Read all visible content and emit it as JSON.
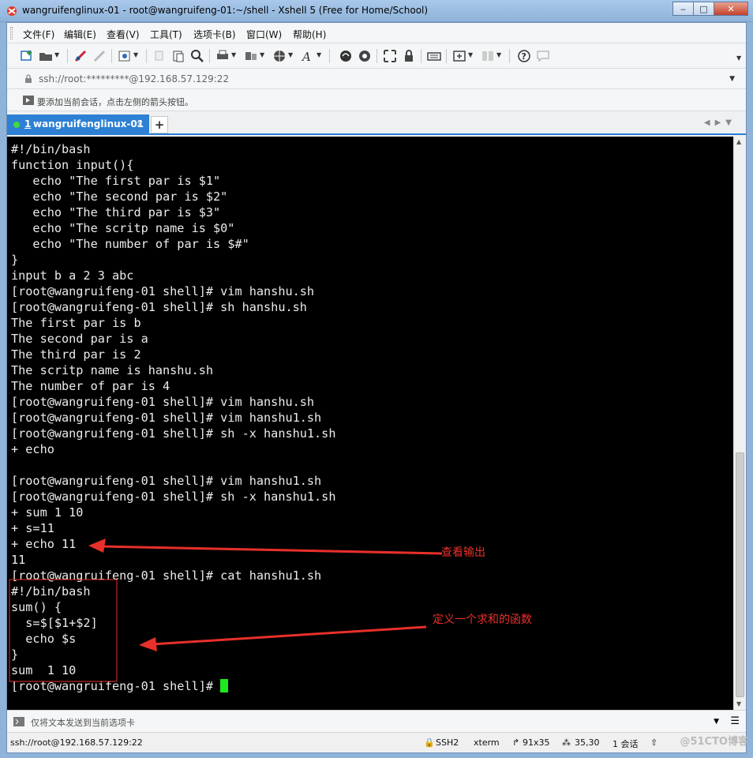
{
  "window": {
    "title": "wangruifenglinux-01 - root@wangruifeng-01:~/shell - Xshell 5 (Free for Home/School)",
    "minimize": "‒",
    "maximize": "□",
    "close": "✕"
  },
  "menubar": {
    "items": [
      "文件(F)",
      "编辑(E)",
      "查看(V)",
      "工具(T)",
      "选项卡(B)",
      "窗口(W)",
      "帮助(H)"
    ]
  },
  "address": {
    "value": "ssh://root:*********@192.168.57.129:22"
  },
  "hint": {
    "text": "要添加当前会话，点击左侧的箭头按钮。"
  },
  "tabs": [
    {
      "number": "1",
      "label": " wangruifenglinux-01",
      "close": "×"
    }
  ],
  "tab_add": "+",
  "terminal": {
    "lines": [
      "#!/bin/bash",
      "function input(){",
      "   echo \"The first par is $1\"",
      "   echo \"The second par is $2\"",
      "   echo \"The third par is $3\"",
      "   echo \"The scritp name is $0\"",
      "   echo \"The number of par is $#\"",
      "}",
      "input b a 2 3 abc",
      "[root@wangruifeng-01 shell]# vim hanshu.sh",
      "[root@wangruifeng-01 shell]# sh hanshu.sh",
      "The first par is b",
      "The second par is a",
      "The third par is 2",
      "The scritp name is hanshu.sh",
      "The number of par is 4",
      "[root@wangruifeng-01 shell]# vim hanshu.sh",
      "[root@wangruifeng-01 shell]# vim hanshu1.sh",
      "[root@wangruifeng-01 shell]# sh -x hanshu1.sh",
      "+ echo",
      "",
      "[root@wangruifeng-01 shell]# vim hanshu1.sh",
      "[root@wangruifeng-01 shell]# sh -x hanshu1.sh",
      "+ sum 1 10",
      "+ s=11",
      "+ echo 11",
      "11",
      "[root@wangruifeng-01 shell]# cat hanshu1.sh",
      "#!/bin/bash",
      "sum() {",
      "  s=$[$1+$2]",
      "  echo $s",
      "}",
      "sum  1 10"
    ],
    "prompt": "[root@wangruifeng-01 shell]# "
  },
  "annotations": {
    "output_label": "查看输出",
    "function_label": "定义一个求和的函数",
    "color": "#e8302a"
  },
  "sendbar": {
    "text": "仅将文本发送到当前选项卡"
  },
  "statusbar": {
    "connection": "ssh://root@192.168.57.129:22",
    "protocol": "SSH2",
    "terminal_type": "xterm",
    "size": "91x35",
    "cursor_pos": "35,30",
    "sessions": "1 会话"
  },
  "watermark": "@51CTO博客"
}
